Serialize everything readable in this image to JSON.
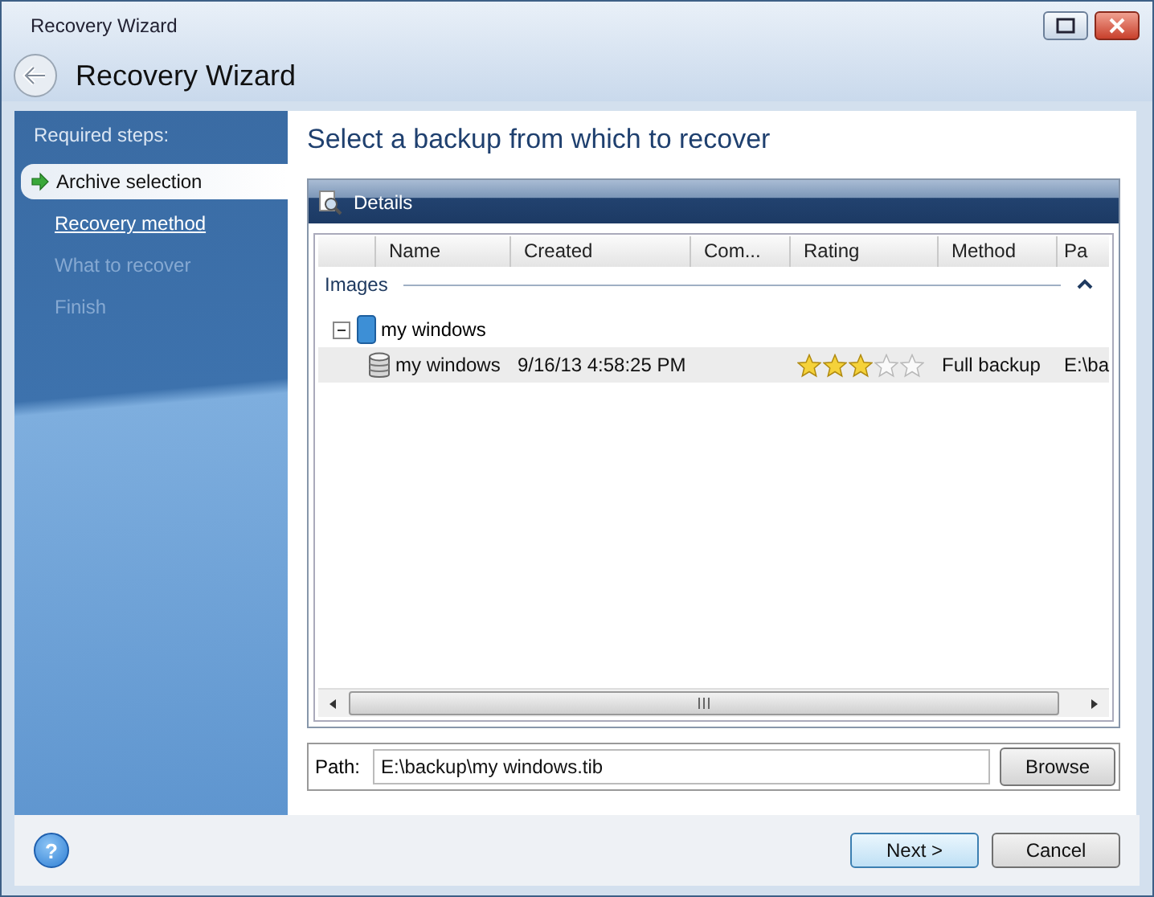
{
  "window": {
    "title": "Recovery Wizard",
    "heading": "Recovery Wizard"
  },
  "sidebar": {
    "title": "Required steps:",
    "steps": [
      {
        "label": "Archive selection",
        "selected": true,
        "disabled": false
      },
      {
        "label": "Recovery method",
        "selected": false,
        "disabled": false
      },
      {
        "label": "What to recover",
        "selected": false,
        "disabled": true
      },
      {
        "label": "Finish",
        "selected": false,
        "disabled": true
      }
    ]
  },
  "page_title": "Select a backup from which to recover",
  "details": {
    "title": "Details",
    "columns": [
      "Name",
      "Created",
      "Com...",
      "Rating",
      "Method",
      "Pa"
    ],
    "group": {
      "label": "Images",
      "expanded": true
    },
    "tree": [
      {
        "name": "my windows",
        "expanded": true,
        "children": [
          {
            "name": "my windows",
            "created": "9/16/13 4:58:25 PM",
            "stars": 3,
            "method": "Full backup",
            "path": "E:\\ba",
            "selected": true
          }
        ]
      }
    ]
  },
  "path": {
    "label": "Path:",
    "value": "E:\\backup\\my windows.tib",
    "button": "Browse"
  },
  "footer": {
    "help": "?",
    "buttons": [
      {
        "label": "Next >",
        "kind": "primary"
      },
      {
        "label": "Cancel",
        "kind": "normal"
      }
    ]
  }
}
